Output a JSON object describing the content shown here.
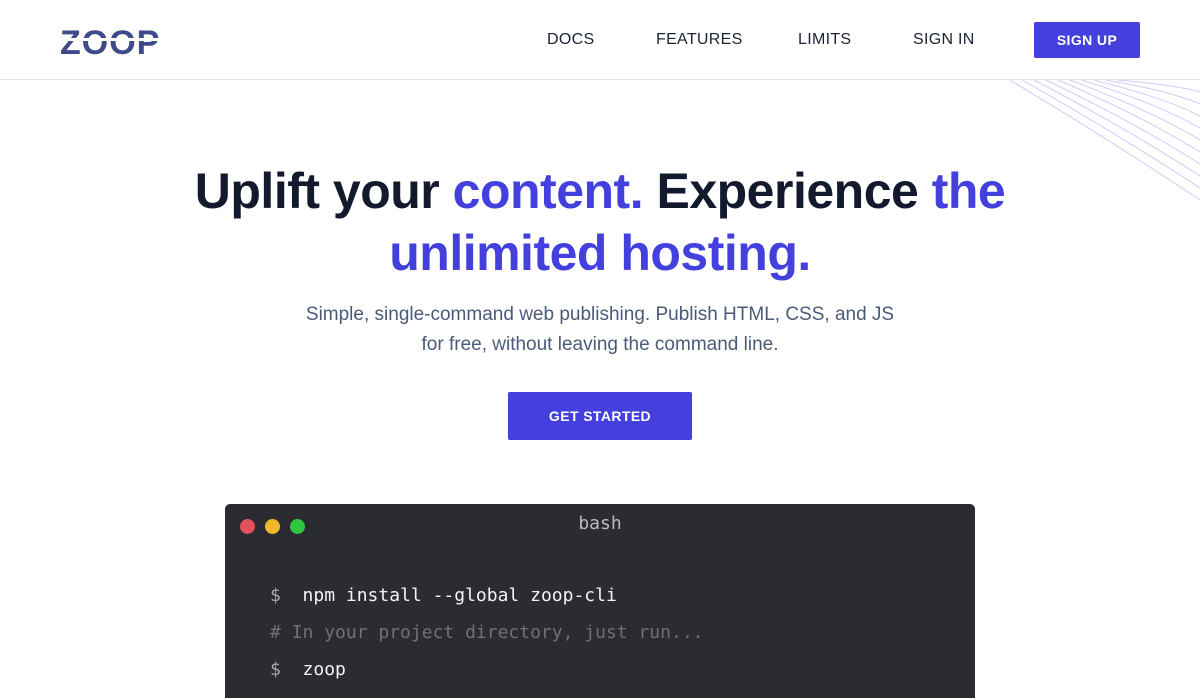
{
  "brand": {
    "name": "ZOOP",
    "colors": {
      "accent": "#4340de",
      "dark_text": "#141a2e",
      "muted_text": "#4a5a78",
      "terminal_bg": "#2a2c31"
    }
  },
  "nav": {
    "docs": "DOCS",
    "features": "FEATURES",
    "limits": "LIMITS",
    "sign_in": "SIGN IN",
    "sign_up": "SIGN UP"
  },
  "hero": {
    "title_part1": "Uplift your ",
    "title_accent1": "content.",
    "title_part2": " Experience ",
    "title_accent2": "the",
    "title_accent3": "unlimited hosting.",
    "subtitle_line1": "Simple, single-command web publishing. Publish HTML, CSS, and JS",
    "subtitle_line2": "for free, without leaving the command line.",
    "cta": "GET STARTED"
  },
  "terminal": {
    "title": "bash",
    "lines": [
      {
        "prompt": "$",
        "text": "npm install --global zoop-cli"
      },
      {
        "prompt": "#",
        "text": "In your project directory, just run..."
      },
      {
        "prompt": "$",
        "text": "zoop"
      }
    ]
  }
}
